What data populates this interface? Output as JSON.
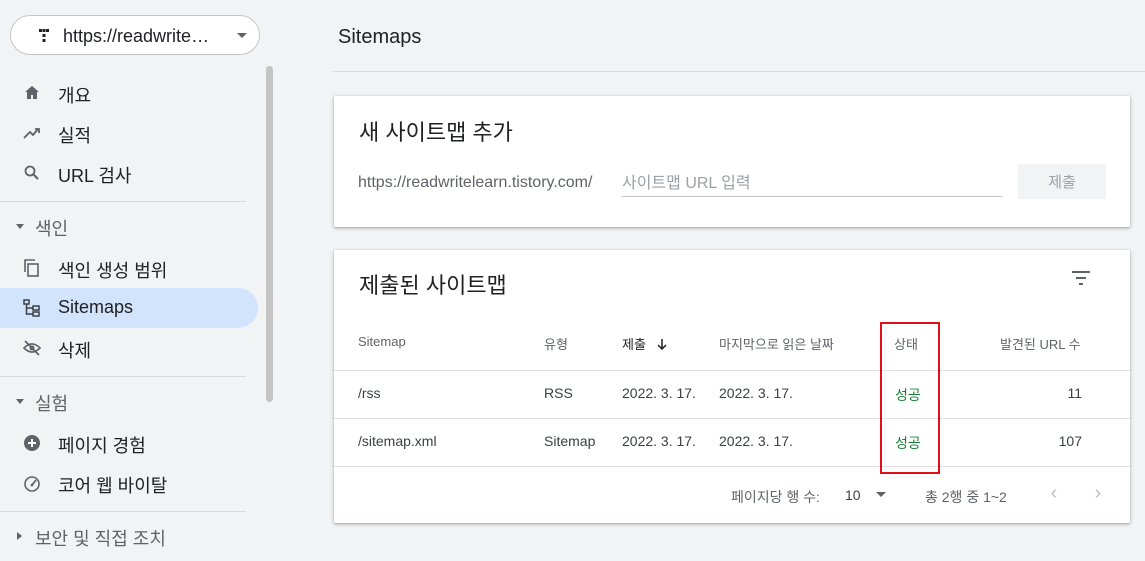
{
  "property": {
    "url": "https://readwritelearn.tistory.com/"
  },
  "sidebar": {
    "items": [
      {
        "label": "개요",
        "icon": "home-icon"
      },
      {
        "label": "실적",
        "icon": "trending-icon"
      },
      {
        "label": "URL 검사",
        "icon": "search-icon"
      }
    ],
    "index_section": {
      "label": "색인",
      "items": [
        {
          "label": "색인 생성 범위",
          "icon": "coverage-icon"
        },
        {
          "label": "Sitemaps",
          "icon": "sitemap-icon",
          "active": true
        },
        {
          "label": "삭제",
          "icon": "hide-icon"
        }
      ]
    },
    "experience_section": {
      "label": "실험",
      "items": [
        {
          "label": "페이지 경험",
          "icon": "plus-circle-icon"
        },
        {
          "label": "코어 웹 바이탈",
          "icon": "gauge-icon"
        }
      ]
    },
    "security_section": {
      "label": "보안 및 직접 조치"
    }
  },
  "page": {
    "title": "Sitemaps"
  },
  "add_sitemap": {
    "title": "새 사이트맵 추가",
    "prefix": "https://readwritelearn.tistory.com/",
    "placeholder": "사이트맵 URL 입력",
    "submit_label": "제출"
  },
  "submitted": {
    "title": "제출된 사이트맵",
    "columns": {
      "sitemap": "Sitemap",
      "type": "유형",
      "submitted": "제출",
      "last_read": "마지막으로 읽은 날짜",
      "status": "상태",
      "urls": "발견된 URL 수"
    },
    "rows": [
      {
        "sitemap": "/rss",
        "type": "RSS",
        "submitted": "2022. 3. 17.",
        "last_read": "2022. 3. 17.",
        "status": "성공",
        "urls": "11"
      },
      {
        "sitemap": "/sitemap.xml",
        "type": "Sitemap",
        "submitted": "2022. 3. 17.",
        "last_read": "2022. 3. 17.",
        "status": "성공",
        "urls": "107"
      }
    ],
    "pager": {
      "rows_per_page_label": "페이지당 행 수:",
      "rows_per_page": "10",
      "range": "총 2행 중 1~2"
    }
  },
  "colors": {
    "active_bg": "#d2e3fc",
    "success": "#188038",
    "highlight": "#e0101a"
  }
}
